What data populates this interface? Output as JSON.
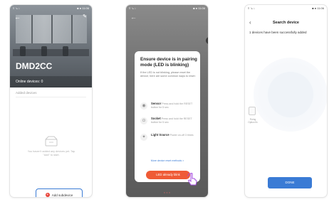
{
  "phone1": {
    "status_left": "≡ ↘ ↓",
    "status_right": "■ ● 11:06",
    "back_icon": "back-arrow-icon",
    "edit_icon": "edit-icon",
    "title": "DMD2CC",
    "online_devices": "Online devices: 0",
    "section_label": "Added devices",
    "empty_text": "You haven't added any devices yet. Tap \"Add\" to start.",
    "add_button": "Add subdevice"
  },
  "phone2": {
    "status_left": "≡ ↘ ↓",
    "status_right": "■ ● 11:06",
    "modal_title": "Ensure device is in pairing mode (LED is blinking)",
    "modal_desc": "If the LED is not blinking, please reset the device; here are some common ways to reset:",
    "rows": [
      {
        "name": "Sensor",
        "desc": "Press and hold the RESET button for 5 sec",
        "icon": "◉"
      },
      {
        "name": "Socket",
        "desc": "Press and hold the RESET button for 5 sec",
        "icon": "⊙"
      },
      {
        "name": "Light Source",
        "desc": "Power on-off 3 times",
        "icon": "✦"
      }
    ],
    "more_link": "More device reset methods >",
    "led_button": "LED already blink",
    "close_label": "×",
    "hand_icon": "pointing-hand-icon"
  },
  "phone3": {
    "status_left": "≡ ↘ ↓",
    "status_right": "■ ● 11:06",
    "title": "Search device",
    "message": "1 devices have been successfully added",
    "device_label": "Fixing Option fix",
    "done_button": "DONE"
  },
  "colors": {
    "accent_blue": "#3a7bd5",
    "led_orange": "#ef5b36",
    "add_red": "#e8443a"
  }
}
